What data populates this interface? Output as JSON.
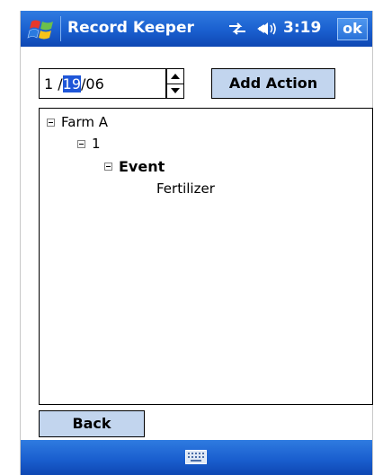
{
  "titlebar": {
    "app_title": "Record Keeper",
    "clock": "3:19",
    "ok_label": "ok",
    "start_icon": "windows-flag-icon",
    "connectivity_icon": "connectivity-icon",
    "volume_icon": "speaker-icon"
  },
  "date_picker": {
    "month": "1 /",
    "day": "19",
    "year": "/06"
  },
  "toolbar": {
    "add_action_label": "Add Action",
    "back_label": "Back"
  },
  "tree": {
    "nodes": [
      {
        "label": "Farm A",
        "expanded": true
      },
      {
        "label": "1",
        "expanded": true
      },
      {
        "label": "Event",
        "expanded": true,
        "bold": true
      },
      {
        "label": "Fertilizer"
      }
    ]
  },
  "bottombar": {
    "input_icon": "keyboard-icon"
  },
  "colors": {
    "bar_blue": "#1a5fcf",
    "button_fill": "#c2d5ee",
    "selection": "#1f56d8"
  }
}
